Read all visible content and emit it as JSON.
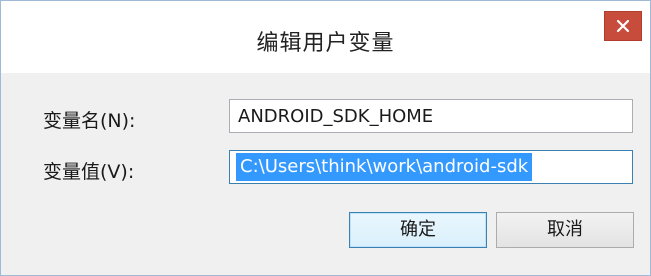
{
  "window": {
    "title": "编辑用户变量",
    "close_icon": "close-icon",
    "close_color": "#c74c3c"
  },
  "form": {
    "name_label": "变量名(N):",
    "name_value": "ANDROID_SDK_HOME",
    "value_label": "变量值(V):",
    "value_value": "C:\\Users\\think\\work\\android-sdk"
  },
  "buttons": {
    "ok_label": "确定",
    "cancel_label": "取消"
  },
  "colors": {
    "selection": "#3399ff",
    "focus_border": "#3c7fb1"
  }
}
